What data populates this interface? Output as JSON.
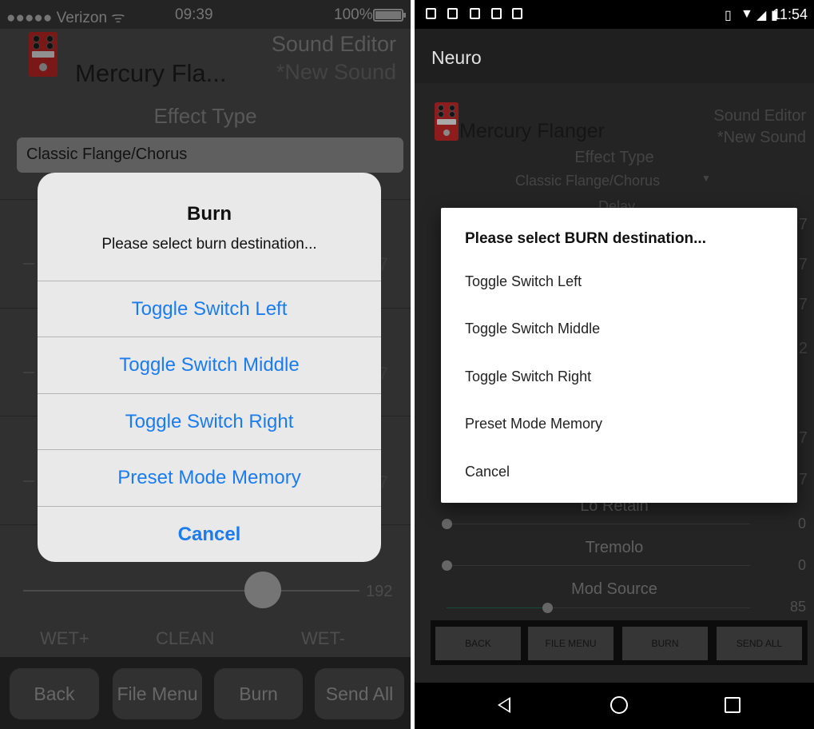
{
  "ios": {
    "statusbar": {
      "carrier": "●●●●● Verizon ᯤ",
      "time": "09:39",
      "battery": "100%"
    },
    "title": "Mercury Fla...",
    "editor": {
      "title": "Sound Editor",
      "subtitle": "*New Sound"
    },
    "effect": {
      "label": "Effect Type",
      "value": "Classic Flange/Chorus"
    },
    "side_values": [
      "7",
      "7",
      "7"
    ],
    "mix": {
      "value": "192",
      "labels": [
        "WET+",
        "CLEAN",
        "WET-"
      ],
      "level": 0.68
    },
    "buttons": [
      "Back",
      "File Menu",
      "Burn",
      "Send All"
    ],
    "alert": {
      "title": "Burn",
      "message": "Please select burn destination...",
      "options": [
        "Toggle Switch Left",
        "Toggle Switch Middle",
        "Toggle Switch Right",
        "Preset Mode Memory"
      ],
      "cancel": "Cancel"
    },
    "colors": {
      "accent": "#1b7cf0",
      "pedal": "#c62828"
    }
  },
  "android": {
    "statusbar": {
      "time": "11:54"
    },
    "appbar_title": "Neuro",
    "title": "Mercury Flanger",
    "editor": {
      "title": "Sound Editor",
      "subtitle": "*New Sound"
    },
    "effect": {
      "label": "Effect Type",
      "value": "Classic Flange/Chorus",
      "ghost": "Delay"
    },
    "side_values": [
      "7",
      "7",
      "7",
      "2",
      "7",
      "7"
    ],
    "params": [
      {
        "label": "Lo Retain",
        "value": "0",
        "level": 0
      },
      {
        "label": "Tremolo",
        "value": "0",
        "level": 0
      },
      {
        "label": "Mod Source",
        "value": "85",
        "level": 0.33
      }
    ],
    "buttons": [
      "BACK",
      "FILE MENU",
      "BURN",
      "SEND ALL"
    ],
    "dialog": {
      "title": "Please select BURN destination...",
      "options": [
        "Toggle Switch Left",
        "Toggle Switch Middle",
        "Toggle Switch Right",
        "Preset Mode Memory",
        "Cancel"
      ]
    },
    "colors": {
      "slider_active": "#1f6b4f"
    }
  }
}
